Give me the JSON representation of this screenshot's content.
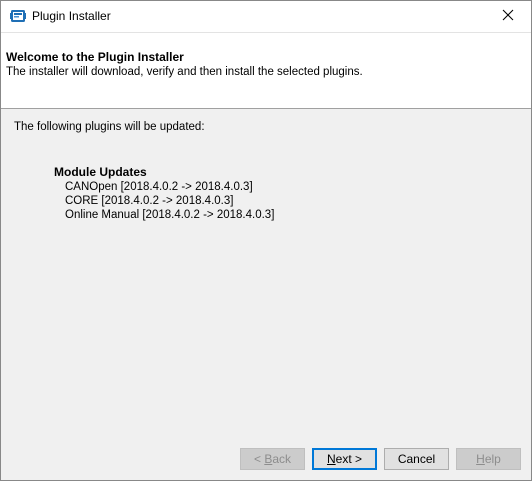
{
  "window": {
    "title": "Plugin Installer",
    "app_icon": "installer-icon",
    "close_icon": "close-icon"
  },
  "header": {
    "title": "Welcome to the Plugin Installer",
    "subtitle": "The installer will download, verify and then install the selected plugins."
  },
  "body": {
    "intro": "The following plugins will be updated:",
    "section_heading": "Module Updates",
    "updates": [
      "CANOpen [2018.4.0.2 -> 2018.4.0.3]",
      "CORE [2018.4.0.2 -> 2018.4.0.3]",
      "Online Manual [2018.4.0.2 -> 2018.4.0.3]"
    ]
  },
  "buttons": {
    "back": {
      "prefix": "< ",
      "mnemonic": "B",
      "rest": "ack",
      "enabled": false
    },
    "next": {
      "mnemonic": "N",
      "rest": "ext >",
      "enabled": true
    },
    "cancel": {
      "label": "Cancel",
      "enabled": true
    },
    "help": {
      "mnemonic": "H",
      "rest": "elp",
      "enabled": false
    }
  },
  "colors": {
    "accent": "#0078d7",
    "window_bg": "#f0f0f0",
    "header_bg": "#ffffff",
    "disabled_text": "#8d8d8d"
  }
}
